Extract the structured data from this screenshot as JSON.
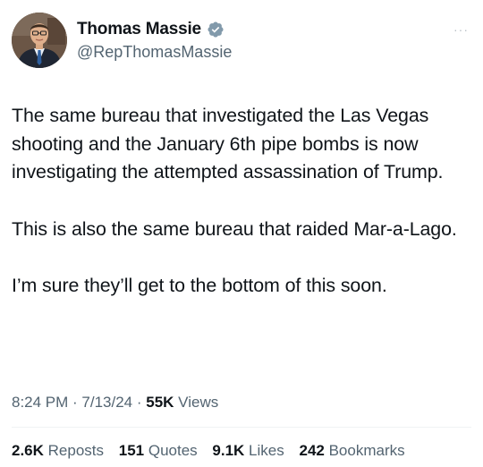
{
  "author": {
    "display_name": "Thomas Massie",
    "handle": "@RepThomasMassie",
    "verified_icon": "verified-badge-icon",
    "verified_color": "#829aab"
  },
  "more_label": "···",
  "body": {
    "paragraphs": [
      "The same bureau that investigated the Las Vegas shooting and the January 6th pipe bombs is now investigating the attempted assassination of Trump.",
      "This is also the same bureau that raided Mar-a-Lago.",
      "I’m sure they’ll get to the bottom of this soon."
    ]
  },
  "meta": {
    "time": "8:24 PM",
    "sep1": " · ",
    "date": "7/13/24",
    "sep2": " · ",
    "views_count": "55K",
    "views_label": " Views"
  },
  "stats": {
    "reposts": {
      "count": "2.6K",
      "label": " Reposts"
    },
    "quotes": {
      "count": "151",
      "label": " Quotes"
    },
    "likes": {
      "count": "9.1K",
      "label": " Likes"
    },
    "bookmarks": {
      "count": "242",
      "label": " Bookmarks"
    }
  },
  "colors": {
    "text": "#0f1419",
    "secondary": "#536471",
    "divider": "#eff3f4"
  }
}
